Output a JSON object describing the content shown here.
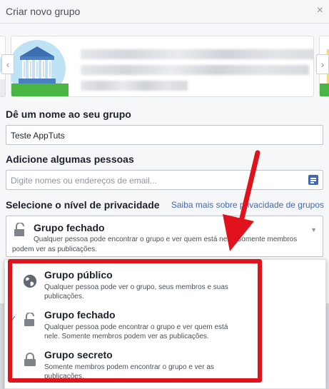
{
  "dialog": {
    "title": "Criar novo grupo",
    "close_glyph": "×",
    "colors": {
      "accent": "#4267b2",
      "highlight": "#e0121c"
    }
  },
  "carousel": {
    "prev_glyph": "‹",
    "next_glyph": "›"
  },
  "name_section": {
    "label": "Dê um nome ao seu grupo",
    "value": "Teste AppTuts"
  },
  "people_section": {
    "label": "Adicione algumas pessoas",
    "placeholder": "Digite nomes ou endereços de email..."
  },
  "privacy_section": {
    "label": "Selecione o nível de privacidade",
    "learn_more": "Saiba mais sobre privacidade de grupos",
    "selected": {
      "title": "Grupo fechado",
      "description": "Qualquer pessoa pode encontrar o grupo e ver quem está nele. Somente membros podem ver as publicações."
    },
    "options": [
      {
        "icon": "globe-icon",
        "title": "Grupo público",
        "description": "Qualquer pessoa pode ver o grupo, seus membros e suas publicações."
      },
      {
        "icon": "lock-open-icon",
        "title": "Grupo fechado",
        "description": "Qualquer pessoa pode encontrar o grupo e ver quem está nele. Somente membros podem ver as publicações.",
        "checked": true
      },
      {
        "icon": "lock-icon",
        "title": "Grupo secreto",
        "description": "Somente membros podem encontrar o grupo e ver as publicações."
      }
    ]
  },
  "check_glyph": "✓",
  "chevron_glyph": "▼"
}
